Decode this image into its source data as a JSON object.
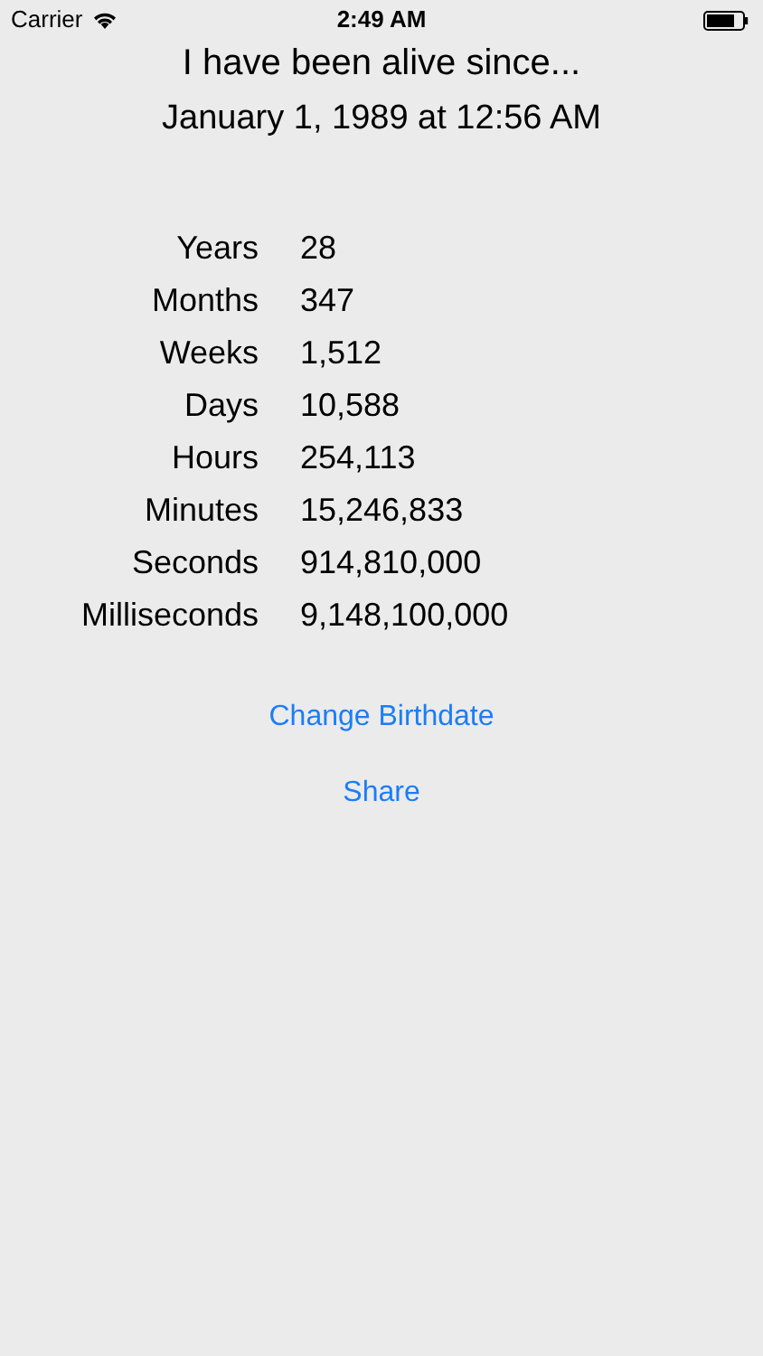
{
  "status_bar": {
    "carrier": "Carrier",
    "time": "2:49 AM"
  },
  "heading": "I have been alive since...",
  "birthdate": "January 1, 1989 at 12:56 AM",
  "stats": [
    {
      "label": "Years",
      "value": "28"
    },
    {
      "label": "Months",
      "value": "347"
    },
    {
      "label": "Weeks",
      "value": "1,512"
    },
    {
      "label": "Days",
      "value": "10,588"
    },
    {
      "label": "Hours",
      "value": "254,113"
    },
    {
      "label": "Minutes",
      "value": "15,246,833"
    },
    {
      "label": "Seconds",
      "value": "914,810,000"
    },
    {
      "label": "Milliseconds",
      "value": "9,148,100,000"
    }
  ],
  "buttons": [
    "Change Birthdate",
    "Share"
  ]
}
